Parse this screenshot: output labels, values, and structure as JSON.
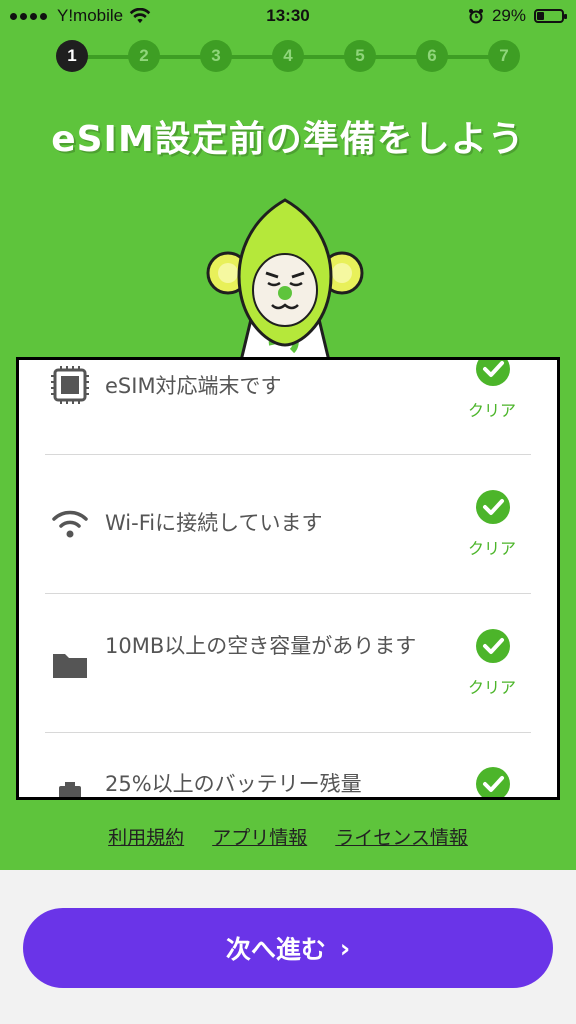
{
  "status_bar": {
    "carrier": "Y!mobile",
    "time": "13:30",
    "battery_percent": "29%",
    "battery_level": 0.29
  },
  "stepper": {
    "steps": [
      "1",
      "2",
      "3",
      "4",
      "5",
      "6",
      "7"
    ],
    "current": 1
  },
  "title": "eSIM設定前の準備をしよう",
  "checklist": [
    {
      "icon": "chip-icon",
      "label": "eSIM対応端末です",
      "status": "クリア"
    },
    {
      "icon": "wifi-icon",
      "label": "Wi-Fiに接続しています",
      "status": "クリア"
    },
    {
      "icon": "folder-icon",
      "label": "10MB以上の空き容量があります",
      "status": "クリア"
    },
    {
      "icon": "battery-icon",
      "label": "25%以上のバッテリー残量",
      "status": ""
    }
  ],
  "links": {
    "terms": "利用規約",
    "app_info": "アプリ情報",
    "license": "ライセンス情報"
  },
  "next_button": {
    "label": "次へ進む",
    "chevron": "›"
  },
  "colors": {
    "green": "#5ec43c",
    "accent_purple": "#6a34e8",
    "check_green": "#4cb52a"
  }
}
